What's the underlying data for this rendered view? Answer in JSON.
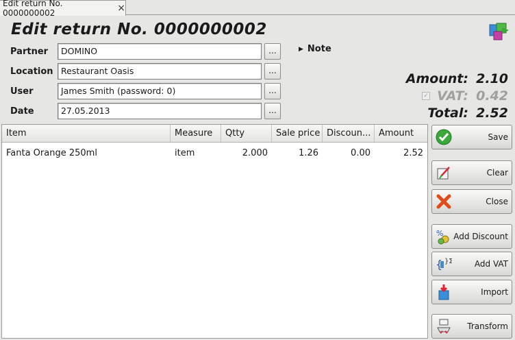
{
  "tab": {
    "label": "Edit return No. 0000000002",
    "close_glyph": "×"
  },
  "title": "Edit return No. 0000000002",
  "form": {
    "partner_label": "Partner",
    "partner_value": "DOMINO",
    "location_label": "Location",
    "location_value": "Restaurant Oasis",
    "user_label": "User",
    "user_value": "James Smith (password: 0)",
    "date_label": "Date",
    "date_value": "27.05.2013",
    "browse_label": "..."
  },
  "note": {
    "label": "Note"
  },
  "totals": {
    "amount_label": "Amount:",
    "amount_value": "2.10",
    "vat_label": "VAT:",
    "vat_value": "0.42",
    "vat_checked": true,
    "total_label": "Total:",
    "total_value": "2.52"
  },
  "grid": {
    "columns": [
      "Item",
      "Measure",
      "Qtty",
      "Sale price",
      "Discoun...",
      "Amount"
    ],
    "rows": [
      {
        "item": "Fanta Orange 250ml",
        "measure": "item",
        "qtty": "2.000",
        "sale_price": "1.26",
        "discount": "0.00",
        "amount": "2.52"
      }
    ]
  },
  "buttons": {
    "save": "Save",
    "clear": "Clear",
    "close": "Close",
    "add_discount": "Add Discount",
    "add_vat": "Add VAT",
    "import": "Import",
    "transform": "Transform"
  },
  "icons": {
    "save": "check-circle-icon",
    "clear": "edit-clear-icon",
    "close": "red-x-icon",
    "add_discount": "discount-icon",
    "add_vat": "sigma-icon",
    "import": "import-box-icon",
    "transform": "transform-icon",
    "app": "app-logo-icon"
  },
  "colors": {
    "accent_green": "#3aa83a",
    "close_red": "#e04b1a"
  }
}
